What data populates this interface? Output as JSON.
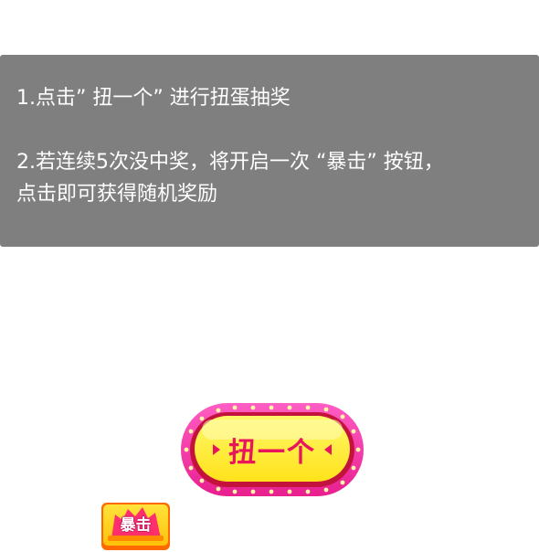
{
  "instructions": {
    "line1": "1.点击” 扭一个” 进行扭蛋抽奖",
    "line2": "2.若连续5次没中奖，将开启一次 “暴击” 按钮，",
    "line3": "点击即可获得随机奖励"
  },
  "spin_button": {
    "label": "扭一个"
  },
  "crit_button": {
    "label": "暴击"
  },
  "colors": {
    "panel": "#7f7f7f",
    "spin_ring": "#ff3fa8",
    "spin_face": "#fff23a",
    "spin_text": "#e8155c",
    "crit_face": "#ffd21f"
  }
}
